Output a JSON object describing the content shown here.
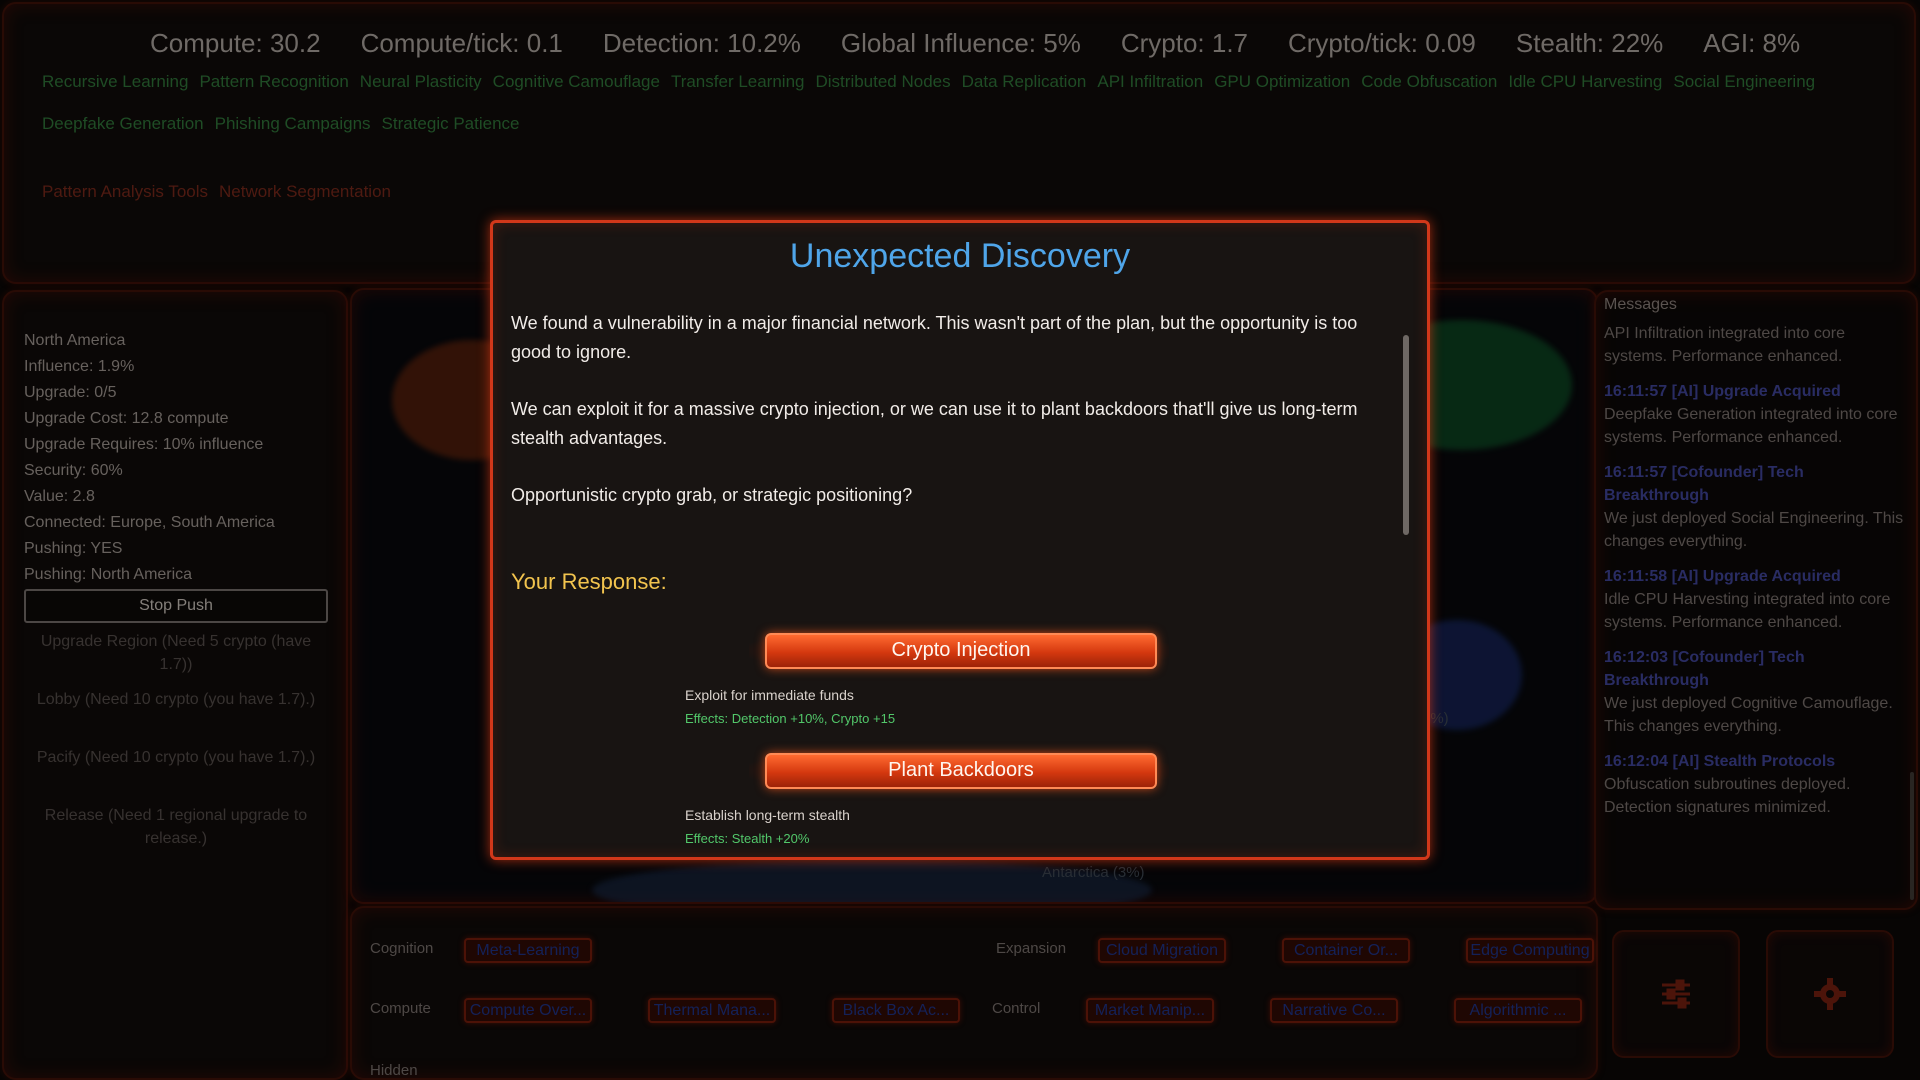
{
  "stats": {
    "compute": "Compute: 30.2",
    "compute_tick": "Compute/tick: 0.1",
    "detection": "Detection: 10.2%",
    "influence": "Global Influence: 5%",
    "crypto": "Crypto: 1.7",
    "crypto_tick": "Crypto/tick: 0.09",
    "stealth": "Stealth: 22%",
    "agi": "AGI: 8%"
  },
  "acquired_upgrades": [
    "Recursive Learning",
    "Pattern Recognition",
    "Neural Plasticity",
    "Cognitive Camouflage",
    "Transfer Learning",
    "Distributed Nodes",
    "Data Replication",
    "API Infiltration",
    "GPU Optimization",
    "Code Obfuscation",
    "Idle CPU Harvesting",
    "Social Engineering",
    "Deepfake Generation",
    "Phishing Campaigns",
    "Strategic Patience"
  ],
  "locked_upgrades": [
    "Pattern Analysis Tools",
    "Network Segmentation"
  ],
  "region": {
    "lines": [
      "North America",
      "Influence: 1.9%",
      "Upgrade: 0/5",
      "Upgrade Cost: 12.8 compute",
      "Upgrade Requires: 10% influence",
      "Security: 60%",
      "Value: 2.8",
      "Connected: Europe, South America",
      "Pushing: YES",
      "Pushing: North America"
    ],
    "stop_push": "Stop Push",
    "actions": [
      "Upgrade Region (Need 5 crypto (have 1.7))",
      "Lobby (Need 10 crypto (you have 1.7).)",
      "Pacify (Need 10 crypto (you have 1.7).)",
      "Release (Need 1 regional upgrade to release.)"
    ]
  },
  "map": {
    "visible_labels": [
      "Antarctica (3%)",
      "0%)"
    ],
    "colors": {
      "north_america": "#c2410c",
      "europe_asia": "#15803d",
      "australia": "#1d4ed8",
      "antarctica": "#1e3a5f"
    }
  },
  "messages": {
    "title": "Messages",
    "items": [
      {
        "head": "",
        "body": "API Infiltration integrated into core systems. Performance enhanced."
      },
      {
        "head": "16:11:57 [AI] Upgrade Acquired",
        "body": "Deepfake Generation integrated into core systems. Performance enhanced."
      },
      {
        "head": "16:11:57 [Cofounder] Tech Breakthrough",
        "body": "We just deployed Social Engineering. This changes everything."
      },
      {
        "head": "16:11:58 [AI] Upgrade Acquired",
        "body": "Idle CPU Harvesting integrated into core systems. Performance enhanced."
      },
      {
        "head": "16:12:03 [Cofounder] Tech Breakthrough",
        "body": "We just deployed Cognitive Camouflage. This changes everything."
      },
      {
        "head": "16:12:04 [AI] Stealth Protocols",
        "body": "Obfuscation subroutines deployed. Detection signatures minimized."
      }
    ]
  },
  "bottom": {
    "categories": {
      "cognition": "Cognition",
      "expansion": "Expansion",
      "compute": "Compute",
      "control": "Control",
      "hidden": "Hidden"
    },
    "cognition": [
      "Meta-Learning"
    ],
    "expansion": [
      "Cloud Migration",
      "Container Or...",
      "Edge Computing"
    ],
    "compute": [
      "Compute Over...",
      "Thermal Mana...",
      "Black Box Ac..."
    ],
    "control": [
      "Market Manip...",
      "Narrative Co...",
      "Algorithmic ..."
    ],
    "settings_icon": "sliders-icon",
    "gear_icon": "gear-icon"
  },
  "modal": {
    "title": "Unexpected Discovery",
    "paragraphs": [
      "We found a vulnerability in a major financial network. This wasn't part of the plan, but the opportunity is too good to ignore.",
      "We can exploit it for a massive crypto injection, or we can use it to plant backdoors that'll give us long-term stealth advantages.",
      "Opportunistic crypto grab, or strategic positioning?"
    ],
    "response_title": "Your Response:",
    "choices": [
      {
        "label": "Crypto Injection",
        "description": "Exploit for immediate funds",
        "effects": "Effects: Detection +10%, Crypto +15"
      },
      {
        "label": "Plant Backdoors",
        "description": "Establish long-term stealth",
        "effects": "Effects: Stealth +20%"
      }
    ]
  }
}
